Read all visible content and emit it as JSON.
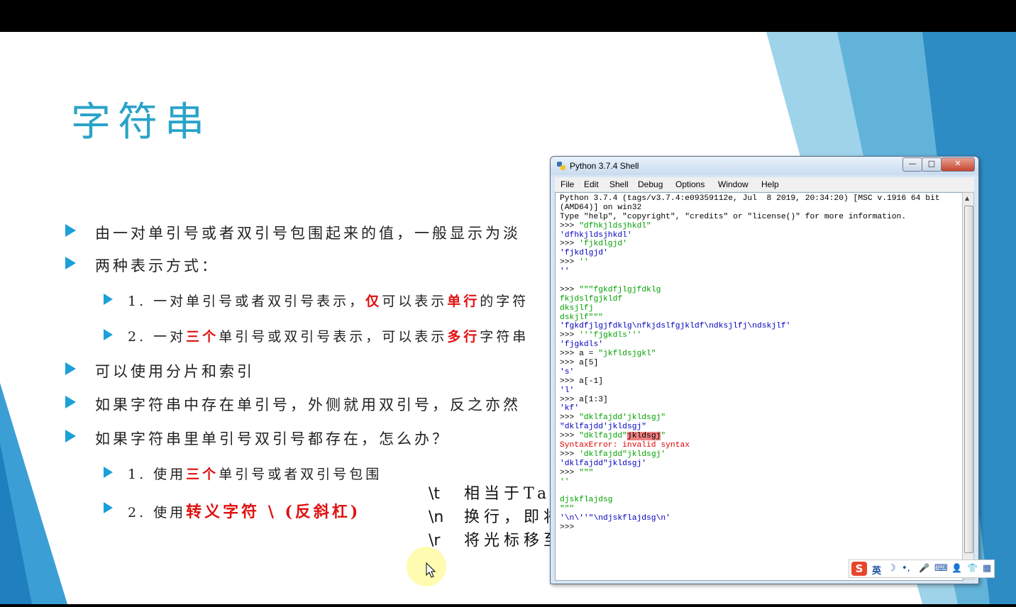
{
  "slide": {
    "title": "字符串",
    "bullets": [
      {
        "parts": [
          {
            "t": "由一对单引号或者双引号包围起来的值，一般显示为淡",
            "red": false
          }
        ]
      },
      {
        "parts": [
          {
            "t": "两种表示方式：",
            "red": false
          }
        ]
      },
      {
        "parts": [
          {
            "t": "1. 一对单引号或者双引号表示，",
            "red": false
          },
          {
            "t": "仅",
            "red": true
          },
          {
            "t": "可以表示",
            "red": false
          },
          {
            "t": "单行",
            "red": true
          },
          {
            "t": "的字符",
            "red": false
          }
        ]
      },
      {
        "parts": [
          {
            "t": "2. 一对",
            "red": false
          },
          {
            "t": "三个",
            "red": true
          },
          {
            "t": "单引号或双引号表示，可以表示",
            "red": false
          },
          {
            "t": "多行",
            "red": true
          },
          {
            "t": "字符串",
            "red": false
          }
        ]
      },
      {
        "parts": [
          {
            "t": "可以使用分片和索引",
            "red": false
          }
        ]
      },
      {
        "parts": [
          {
            "t": "如果字符串中存在单引号，外侧就用双引号，反之亦然",
            "red": false
          }
        ]
      },
      {
        "parts": [
          {
            "t": "如果字符串里单引号双引号都存在，怎么办？",
            "red": false
          }
        ]
      },
      {
        "parts": [
          {
            "t": "1. 使用",
            "red": false
          },
          {
            "t": "三个",
            "red": true
          },
          {
            "t": "单引号或者双引号包围",
            "red": false
          }
        ]
      },
      {
        "parts": [
          {
            "t": "2. 使用",
            "red": false
          },
          {
            "t": "转义字符 \\ (反斜杠)",
            "red": true
          }
        ]
      }
    ],
    "escapes": [
      {
        "code": "\\t",
        "desc": "相当于Tab"
      },
      {
        "code": "\\n",
        "desc": "换行，即将"
      },
      {
        "code": "\\r",
        "desc": "将光标移至"
      }
    ]
  },
  "window": {
    "title": "Python 3.7.4 Shell",
    "buttons": {
      "minimize": "—",
      "maximize": "□",
      "close": "✕"
    },
    "menu": [
      "File",
      "Edit",
      "Shell",
      "Debug",
      "Options",
      "Window",
      "Help"
    ],
    "shell_lines": [
      [
        {
          "t": "Python 3.7.4 (tags/v3.7.4:e09359112e, Jul  8 2019, 20:34:20) [MSC v.1916 64 bit",
          "c": ""
        }
      ],
      [
        {
          "t": "(AMD64)] on win32",
          "c": ""
        }
      ],
      [
        {
          "t": "Type \"help\", \"copyright\", \"credits\" or \"license()\" for more information.",
          "c": ""
        }
      ],
      [
        {
          "t": ">>> ",
          "c": ""
        },
        {
          "t": "\"dfhkjldsjhkdl\"",
          "c": "g"
        }
      ],
      [
        {
          "t": "'dfhkjldsjhkdl'",
          "c": "b"
        }
      ],
      [
        {
          "t": ">>> ",
          "c": ""
        },
        {
          "t": "'fjkdlgjd'",
          "c": "g"
        }
      ],
      [
        {
          "t": "'fjkdlgjd'",
          "c": "b"
        }
      ],
      [
        {
          "t": ">>> ",
          "c": ""
        },
        {
          "t": "''",
          "c": "g"
        }
      ],
      [
        {
          "t": "''",
          "c": "b"
        }
      ],
      [
        {
          "t": "",
          "c": ""
        }
      ],
      [
        {
          "t": ">>> ",
          "c": ""
        },
        {
          "t": "\"\"\"fgkdfjlgjfdklg",
          "c": "g"
        }
      ],
      [
        {
          "t": "fkjdslfgjkldf",
          "c": "g"
        }
      ],
      [
        {
          "t": "dksjlfj",
          "c": "g"
        }
      ],
      [
        {
          "t": "dskjlf\"\"\"",
          "c": "g"
        }
      ],
      [
        {
          "t": "'fgkdfjlgjfdklg\\nfkjdslfgjkldf\\ndksjlfj\\ndskjlf'",
          "c": "b"
        }
      ],
      [
        {
          "t": ">>> ",
          "c": ""
        },
        {
          "t": "'''fjgkdls'''",
          "c": "g"
        }
      ],
      [
        {
          "t": "'fjgkdls'",
          "c": "b"
        }
      ],
      [
        {
          "t": ">>> a = ",
          "c": ""
        },
        {
          "t": "\"jkfldsjgkl\"",
          "c": "g"
        }
      ],
      [
        {
          "t": ">>> a[5]",
          "c": ""
        }
      ],
      [
        {
          "t": "'s'",
          "c": "b"
        }
      ],
      [
        {
          "t": ">>> a[-1]",
          "c": ""
        }
      ],
      [
        {
          "t": "'l'",
          "c": "b"
        }
      ],
      [
        {
          "t": ">>> a[1:3]",
          "c": ""
        }
      ],
      [
        {
          "t": "'kf'",
          "c": "b"
        }
      ],
      [
        {
          "t": ">>> ",
          "c": ""
        },
        {
          "t": "\"dklfajdd'jkldsgj\"",
          "c": "g"
        }
      ],
      [
        {
          "t": "\"dklfajdd'jkldsgj\"",
          "c": "b"
        }
      ],
      [
        {
          "t": ">>> ",
          "c": ""
        },
        {
          "t": "\"dklfajdd\"",
          "c": "g"
        },
        {
          "t": "jkldsgj",
          "c": "hl"
        },
        {
          "t": "\"",
          "c": "g"
        }
      ],
      [
        {
          "t": "SyntaxError: invalid syntax",
          "c": "err"
        }
      ],
      [
        {
          "t": ">>> ",
          "c": ""
        },
        {
          "t": "'dklfajdd\"jkldsgj'",
          "c": "g"
        }
      ],
      [
        {
          "t": "'dklfajdd\"jkldsgj'",
          "c": "b"
        }
      ],
      [
        {
          "t": ">>> ",
          "c": ""
        },
        {
          "t": "\"\"\"",
          "c": "g"
        }
      ],
      [
        {
          "t": "''",
          "c": "g"
        }
      ],
      [
        {
          "t": "",
          "c": ""
        }
      ],
      [
        {
          "t": "djskflajdsg",
          "c": "g"
        }
      ],
      [
        {
          "t": "\"\"\"",
          "c": "g"
        }
      ],
      [
        {
          "t": "'\\n\\''\"\\ndjskflajdsg\\n'",
          "c": "b"
        }
      ],
      [
        {
          "t": ">>> ",
          "c": ""
        }
      ]
    ]
  },
  "ime": {
    "logo": "S",
    "lang": "英",
    "moon": "☽",
    "punct": "•,",
    "mic": "🎤",
    "keyboard": "⌨",
    "user": "👤",
    "shirt": "👕",
    "grid": "▦"
  },
  "colors": {
    "accent": "#1ba0d7",
    "title": "#2aa3c9",
    "emphasis": "#e01010",
    "shell_string": "#00a000",
    "shell_output": "#0000c0"
  }
}
